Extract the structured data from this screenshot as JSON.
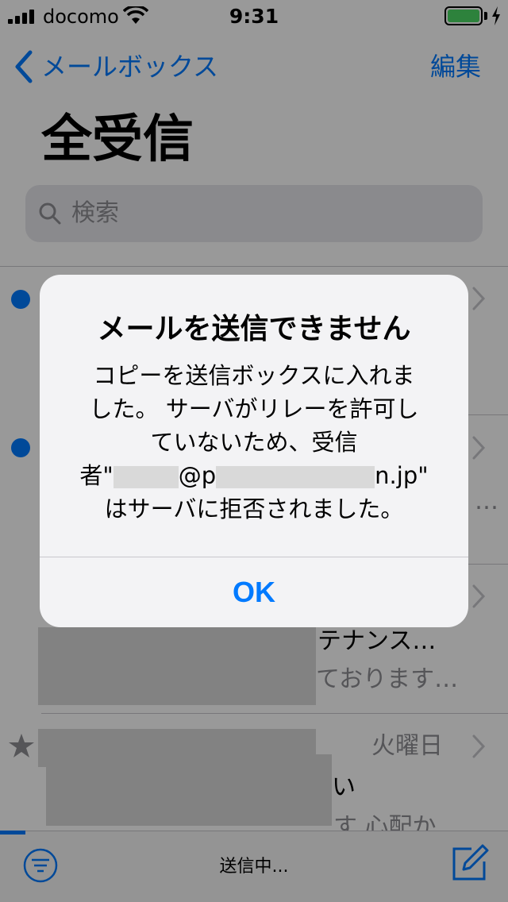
{
  "status_bar": {
    "carrier": "docomo",
    "time": "9:31"
  },
  "nav": {
    "back_label": "メールボックス",
    "edit_label": "編集"
  },
  "page": {
    "title": "全受信"
  },
  "search": {
    "placeholder": "検索"
  },
  "rows": {
    "row3_subject": "テナンス…",
    "row3_preview": "ております…",
    "row4_date": "火曜日",
    "row4_line2": "い",
    "row4_preview": "す 心配か…",
    "row2_extra": "…"
  },
  "toolbar": {
    "status": "送信中..."
  },
  "alert": {
    "title": "メールを送信できません",
    "message_line1": "コピーを送信ボックスに入れま",
    "message_line2": "した。 サーバがリレーを許可し",
    "message_line3": "ていないため、受信",
    "message_line4_prefix": "者\"",
    "message_line4_at": "@p",
    "message_line4_suffix": "n.jp\"",
    "message_line5": "はサーバに拒否されました。",
    "ok_label": "OK"
  },
  "colors": {
    "accent": "#007aff",
    "battery": "#4cd964",
    "unread": "#007aff"
  }
}
